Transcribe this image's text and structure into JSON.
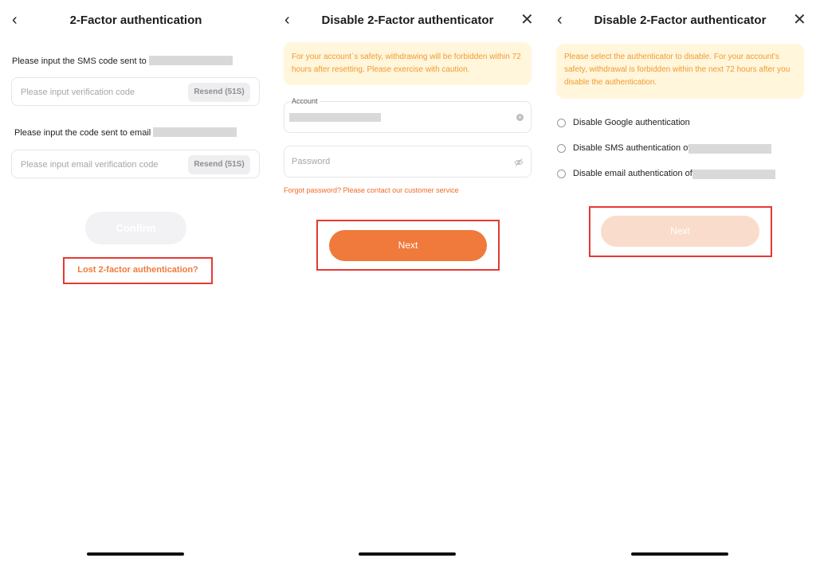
{
  "screen1": {
    "title": "2-Factor authentication",
    "sms_label": "Please input the SMS code sent to",
    "sms_placeholder": "Please input verification code",
    "sms_resend": "Resend (51S)",
    "email_label": "Please input the code sent to email",
    "email_placeholder": "Please input email verification code",
    "email_resend": "Resend (51S)",
    "confirm_label": "Confirm",
    "lost_link": "Lost 2-factor authentication?"
  },
  "screen2": {
    "title": "Disable 2-Factor authenticator",
    "warning": "For your account`s safety, withdrawing will be forbidden within 72 hours after resetting. Please exercise with caution.",
    "account_label": "Account",
    "password_placeholder": "Password",
    "forgot_link": "Forgot password? Please contact our customer service",
    "next_label": "Next"
  },
  "screen3": {
    "title": "Disable 2-Factor authenticator",
    "warning": "Please select the authenticator to disable. For your account's safety, withdrawal is forbidden within the next 72 hours after you disable the authentication.",
    "options": [
      {
        "label": "Disable Google authentication"
      },
      {
        "label": "Disable SMS authentication of"
      },
      {
        "label": "Disable email authentication of"
      }
    ],
    "next_label": "Next"
  },
  "icons": {
    "back": "chevron-left-icon",
    "close": "close-icon",
    "clear": "clear-circle-icon",
    "eye_off": "eye-off-icon"
  },
  "colors": {
    "accent": "#ef7a3b",
    "highlight": "#e53935",
    "warning_bg": "#fff6dc",
    "warning_text": "#f29a2e"
  }
}
